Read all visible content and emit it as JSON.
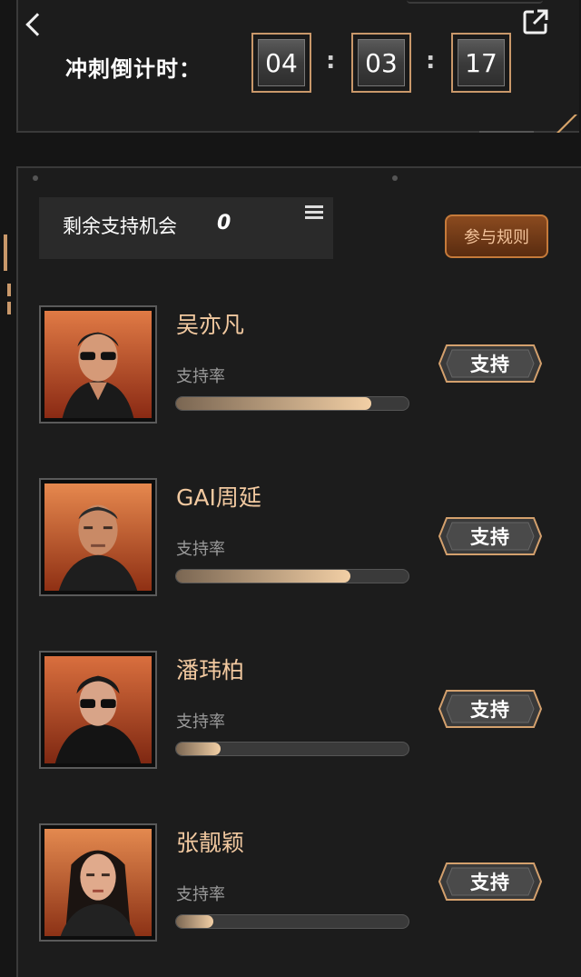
{
  "header": {
    "countdown_label": "冲刺倒计时：",
    "countdown": [
      "04",
      "03",
      "17"
    ]
  },
  "panel": {
    "chances_label": "剩余支持机会",
    "chances_count": "0",
    "rules_button": "参与规则"
  },
  "candidates": [
    {
      "name": "吴亦凡",
      "rate_label": "支持率",
      "support_rate": 0.84,
      "button": "支持"
    },
    {
      "name": "GAI周延",
      "rate_label": "支持率",
      "support_rate": 0.75,
      "button": "支持"
    },
    {
      "name": "潘玮柏",
      "rate_label": "支持率",
      "support_rate": 0.19,
      "button": "支持"
    },
    {
      "name": "张靓颖",
      "rate_label": "支持率",
      "support_rate": 0.16,
      "button": "支持"
    }
  ],
  "colors": {
    "accent": "#f2cfa5",
    "name": "#f2c9a0",
    "frame": "#c9986a",
    "background": "#151515"
  }
}
